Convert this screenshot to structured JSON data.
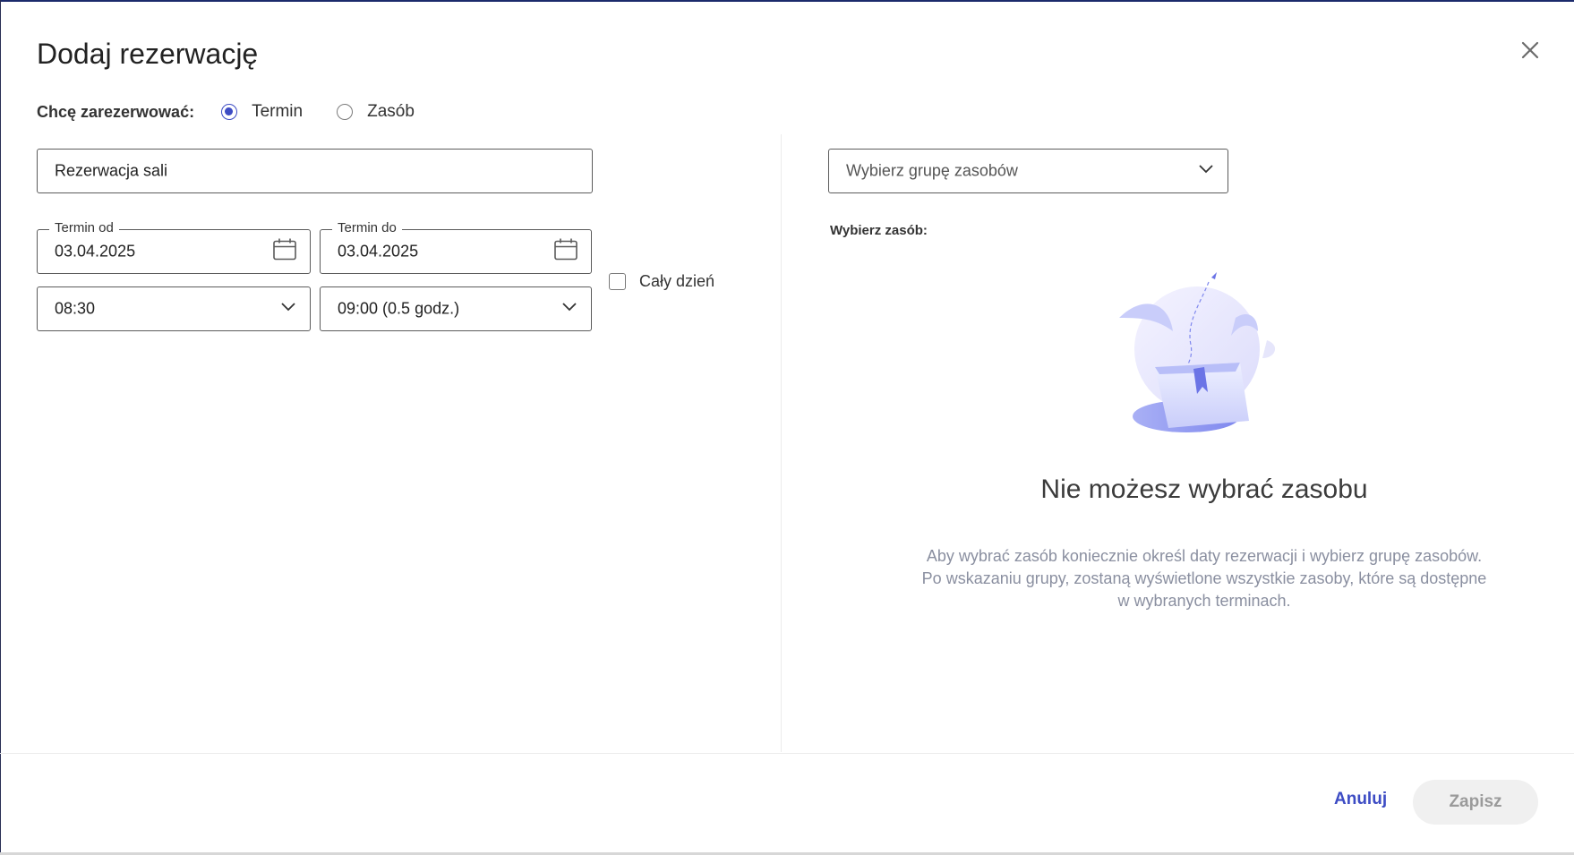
{
  "dialog": {
    "title": "Dodaj rezerwację",
    "close_icon": "close-icon"
  },
  "booking_mode": {
    "caption": "Chcę zarezerwować:",
    "options": [
      {
        "label": "Termin",
        "selected": true
      },
      {
        "label": "Zasób",
        "selected": false
      }
    ]
  },
  "form": {
    "name_value": "Rezerwacja sali",
    "date_from": {
      "legend": "Termin od",
      "value": "03.04.2025",
      "icon": "calendar-icon"
    },
    "date_to": {
      "legend": "Termin do",
      "value": "03.04.2025",
      "icon": "calendar-icon"
    },
    "time_from": {
      "value": "08:30",
      "icon": "chevron-down-icon"
    },
    "time_to": {
      "value": "09:00 (0.5 godz.)",
      "icon": "chevron-down-icon"
    },
    "all_day": {
      "label": "Cały dzień",
      "checked": false
    }
  },
  "resources": {
    "group_placeholder": "Wybierz grupę zasobów",
    "select_label": "Wybierz zasób:",
    "empty_title": "Nie możesz wybrać zasobu",
    "empty_desc": [
      "Aby wybrać zasób koniecznie określ daty rezerwacji i wybierz grupę zasobów.",
      "Po wskazaniu grupy, zostaną wyświetlone wszystkie zasoby, które są dostępne",
      "w wybranych terminach."
    ],
    "illustration": "empty-folder-illustration"
  },
  "footer": {
    "cancel_label": "Anuluj",
    "save_label": "Zapisz"
  },
  "colors": {
    "accent": "#3d4cc4",
    "muted_text": "#8a8fa0",
    "disabled_bg": "#f0f0f0"
  }
}
